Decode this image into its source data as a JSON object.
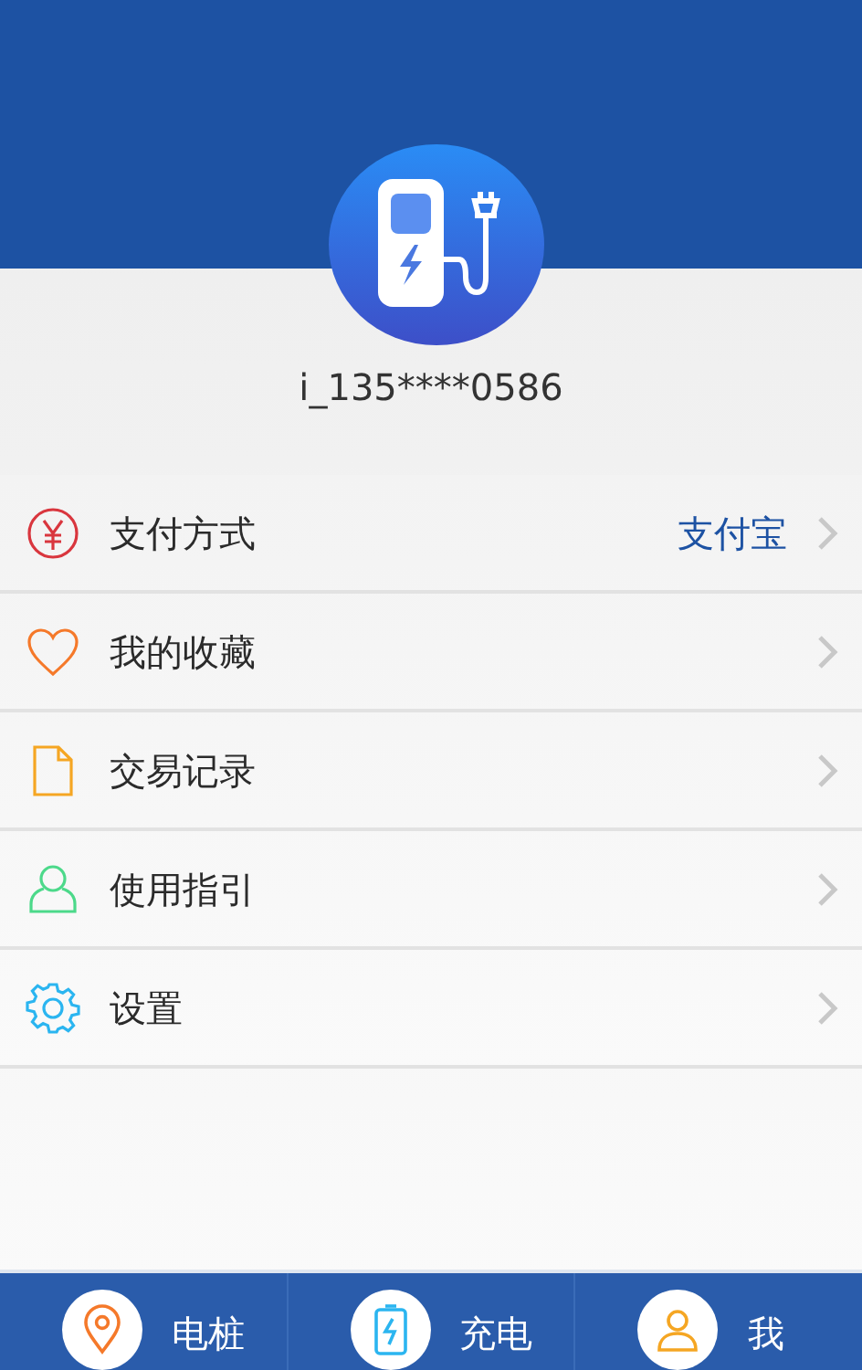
{
  "profile": {
    "username": "i_135****0586"
  },
  "menu": [
    {
      "kind": "payment",
      "color": "#d9363e",
      "label": "支付方式",
      "value": "支付宝"
    },
    {
      "kind": "favorites",
      "color": "#f5792a",
      "label": "我的收藏"
    },
    {
      "kind": "records",
      "color": "#f5a623",
      "label": "交易记录"
    },
    {
      "kind": "guide",
      "color": "#4cd98a",
      "label": "使用指引"
    },
    {
      "kind": "settings",
      "color": "#2bb5f0",
      "label": "设置"
    }
  ],
  "tab_bar": [
    {
      "kind": "pin",
      "label": "电桩"
    },
    {
      "kind": "battery",
      "label": "充电"
    },
    {
      "kind": "person",
      "label": "我"
    }
  ]
}
